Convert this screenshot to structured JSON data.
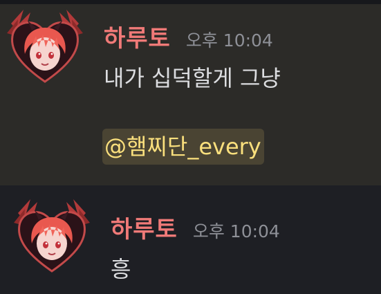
{
  "messages": [
    {
      "author": "하루토",
      "time": "오후 10:04",
      "text": "내가 십덕할게 그냥",
      "mention": "@햄찌단_every"
    },
    {
      "author": "하루토",
      "time": "오후 10:04",
      "text": "흥"
    }
  ],
  "colors": {
    "author": "#f07a78",
    "timestamp": "#8e9097",
    "text": "#dcdde0",
    "mention_text": "#fbe07d",
    "mention_bg": "#4a4433",
    "highlight_bg": "#2c2b28",
    "background": "#1e1f24"
  },
  "icons": {
    "avatar": "anime-avatar-red-wings-heart-frame"
  }
}
